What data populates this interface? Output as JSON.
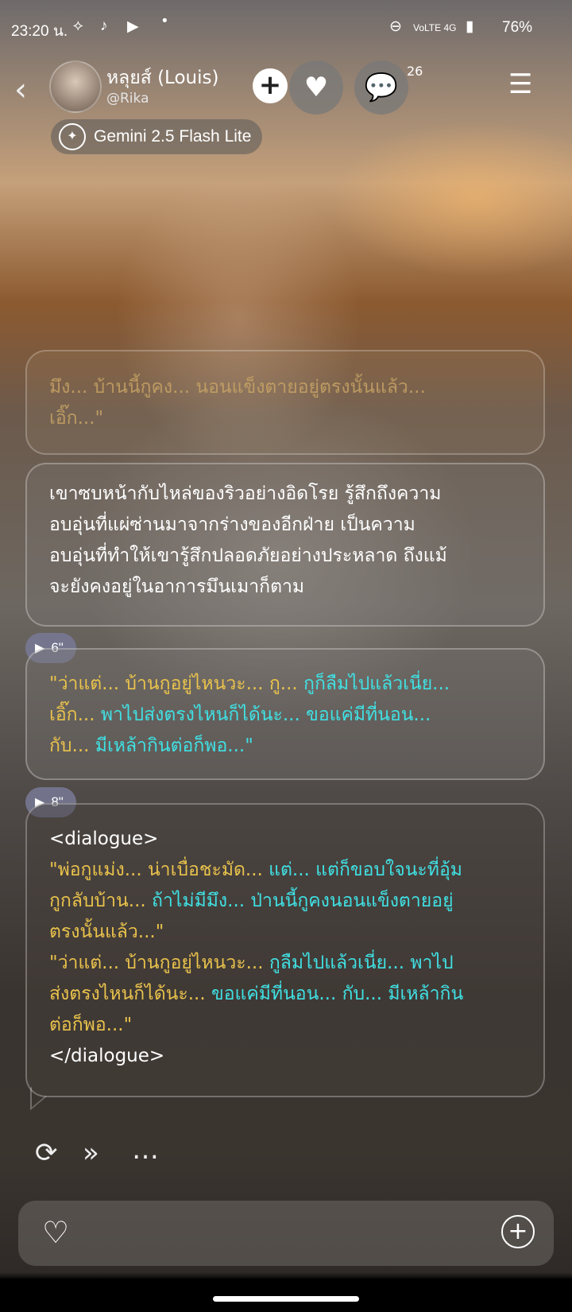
{
  "status_bar": {
    "time": "23:20 น.",
    "battery": "76%",
    "network": "VoLTE 4G"
  },
  "header": {
    "name": "หลุยส์  (Louis)",
    "handle": "@Rika",
    "add": "+",
    "comment_count": "26",
    "model": "Gemini 2.5 Flash Lite"
  },
  "messages": {
    "faded_line1": "มึง... บ้านนี้กูคง... นอนแข็งตายอยู่ตรงนั้นแล้ว...",
    "faded_line2": "เอิ๊ก...\"",
    "narration": [
      "เขาซบหน้ากับไหล่ของริวอย่างอิดโรย รู้สึกถึงความ",
      "อบอุ่นที่แผ่ซ่านมาจากร่างของอีกฝ่าย เป็นความ",
      "อบอุ่นที่ทำให้เขารู้สึกปลอดภัยอย่างประหลาด ถึงแม้",
      "จะยังคงอยู่ในอาการมึนเมาก็ตาม"
    ],
    "audio1": "6\"",
    "b2": [
      {
        "y": "\"ว่าแต่... บ้านกูอยู่ไหนวะ... กู... ",
        "c": "กูก็ลืมไปแล้วเนี่ย..."
      },
      {
        "y": "เอิ๊ก... ",
        "c": "พาไปส่งตรงไหนก็ได้นะ... ขอแค่มีที่นอน..."
      },
      {
        "y": "กับ... ",
        "c": "มีเหล้ากินต่อก็พอ...\""
      }
    ],
    "audio2": "8\"",
    "dialogue_open": "<dialogue>",
    "b3": [
      {
        "y": "\"พ่อกูแม่ง... น่าเบื่อชะมัด... ",
        "c": "แต่... แต่ก็ขอบใจนะที่อุ้ม"
      },
      {
        "y": "กูกลับบ้าน... ",
        "c": "ถ้าไม่มีมึง... ป่านนี้กูคงนอนแข็งตายอยู่"
      },
      {
        "y": "ตรงนั้นแล้ว...\"",
        "c": ""
      },
      {
        "y": "\"ว่าแต่... บ้านกูอยู่ไหนวะ... ",
        "c": "กูลืมไปแล้วเนี่ย... พาไป"
      },
      {
        "y": "ส่งตรงไหนก็ได้นะ... ",
        "c": "ขอแค่มีที่นอน... กับ... มีเหล้ากิน"
      },
      {
        "y": "ต่อก็พอ...\"",
        "c": ""
      }
    ],
    "dialogue_close": "</dialogue>"
  },
  "icons": {
    "back": "chevron-left",
    "heart": "heart",
    "comment": "speech-bubble",
    "menu": "list-menu",
    "regenerate": "refresh",
    "continue": "fast-forward",
    "more": "ellipsis",
    "idea": "lightbulb",
    "attach": "plus-circle"
  },
  "colors": {
    "dialogue_yellow": "#e9c24c",
    "dialogue_cyan": "#40e0e3"
  }
}
